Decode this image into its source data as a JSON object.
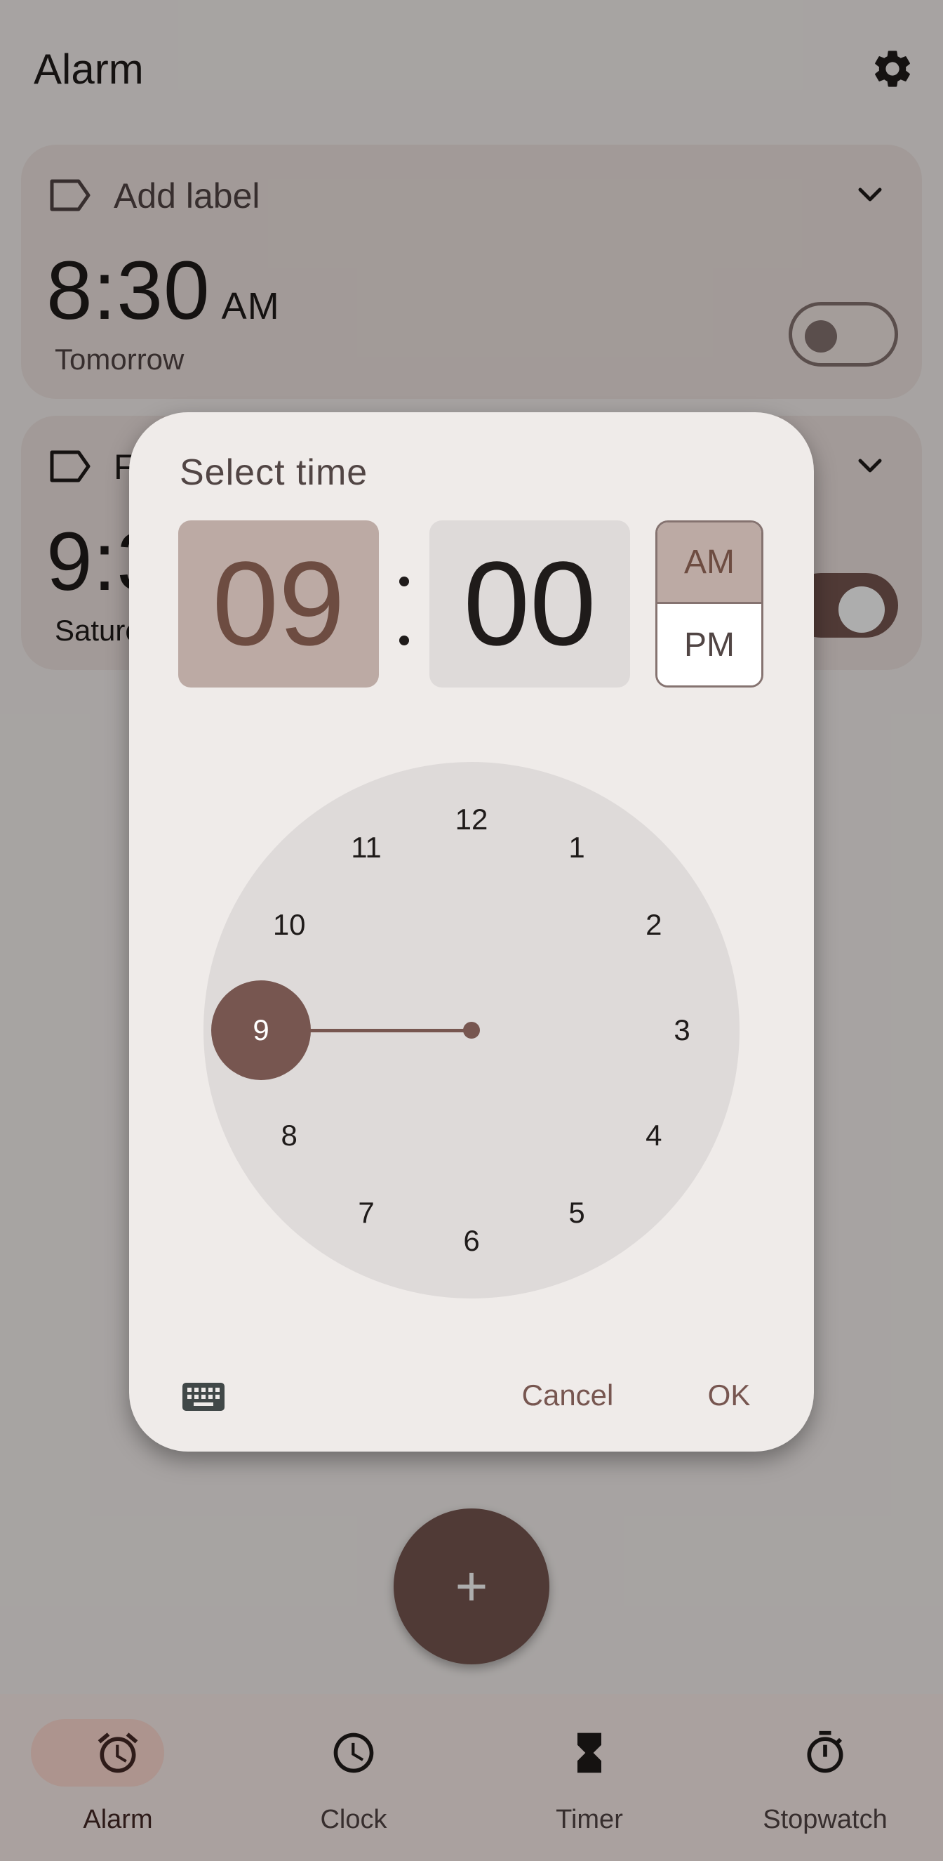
{
  "header": {
    "title": "Alarm"
  },
  "alarms": [
    {
      "label": "Add label",
      "time": "8:30",
      "ampm": "AM",
      "days": "Tomorrow",
      "enabled": false
    },
    {
      "label": "F",
      "time": "9:3",
      "days": "Saturc",
      "enabled": true
    }
  ],
  "dialog": {
    "title": "Select time",
    "hour": "09",
    "minute": "00",
    "am_label": "AM",
    "pm_label": "PM",
    "selected_period": "AM",
    "clock_numbers": [
      "12",
      "1",
      "2",
      "3",
      "4",
      "5",
      "6",
      "7",
      "8",
      "9",
      "10",
      "11"
    ],
    "selected_hour": 9,
    "cancel_label": "Cancel",
    "ok_label": "OK"
  },
  "fab": {
    "symbol": "+"
  },
  "nav": {
    "items": [
      {
        "label": "Alarm",
        "icon": "alarm-icon",
        "active": true
      },
      {
        "label": "Clock",
        "icon": "clock-icon",
        "active": false
      },
      {
        "label": "Timer",
        "icon": "hourglass-icon",
        "active": false
      },
      {
        "label": "Stopwatch",
        "icon": "stopwatch-icon",
        "active": false
      }
    ]
  },
  "colors": {
    "primary": "#775650",
    "primary_container": "#bcaaa4",
    "surface": "#efebe9",
    "clock_face": "#dedad9",
    "on_surface": "#1f1b1a"
  }
}
